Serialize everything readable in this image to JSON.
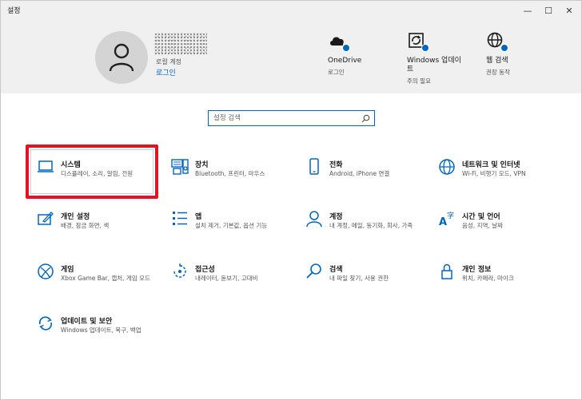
{
  "window": {
    "title": "설정",
    "min": "—",
    "max": "☐",
    "close": "✕"
  },
  "account": {
    "type": "로컬 계정",
    "login": "로그인"
  },
  "header_items": [
    {
      "label": "OneDrive",
      "sub": "로그인"
    },
    {
      "label": "Windows 업데이트",
      "sub": "주의 필요"
    },
    {
      "label": "웹 검색",
      "sub": "권장 동작"
    }
  ],
  "search": {
    "placeholder": "설정 검색"
  },
  "categories": [
    {
      "label": "시스템",
      "sub": "디스플레이, 소리, 알림, 전원"
    },
    {
      "label": "장치",
      "sub": "Bluetooth, 프린터, 마우스"
    },
    {
      "label": "전화",
      "sub": "Android, iPhone 연결"
    },
    {
      "label": "네트워크 및 인터넷",
      "sub": "Wi-Fi, 비행기 모드, VPN"
    },
    {
      "label": "개인 설정",
      "sub": "배경, 잠금 화면, 색"
    },
    {
      "label": "앱",
      "sub": "설치 제거, 기본값, 옵션 기능"
    },
    {
      "label": "계정",
      "sub": "내 계정, 메일, 동기화, 회사, 가족"
    },
    {
      "label": "시간 및 언어",
      "sub": "음성, 지역, 날짜"
    },
    {
      "label": "게임",
      "sub": "Xbox Game Bar, 캡처, 게임 모드"
    },
    {
      "label": "접근성",
      "sub": "내레이터, 돋보기, 고대비"
    },
    {
      "label": "검색",
      "sub": "내 파일 찾기, 사용 권한"
    },
    {
      "label": "개인 정보",
      "sub": "위치, 카메라, 마이크"
    },
    {
      "label": "업데이트 및 보안",
      "sub": "Windows 업데이트, 복구, 백업"
    }
  ],
  "colors": {
    "accent": "#0067c0",
    "highlight": "#e81123",
    "header_bg": "#f0f0f0"
  }
}
